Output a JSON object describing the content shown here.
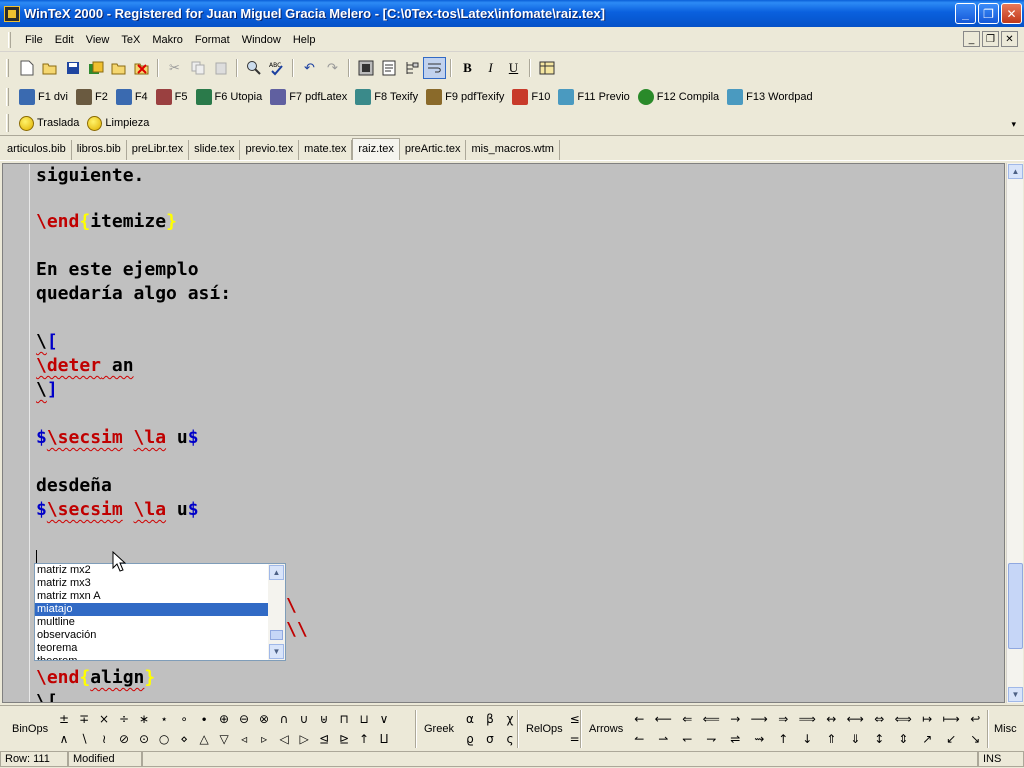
{
  "window": {
    "title": "WinTeX 2000 - Registered for Juan Miguel Gracia Melero - [C:\\0Tex-tos\\Latex\\infomate\\raiz.tex]",
    "minimize": "_",
    "maximize": "❐",
    "close": "✕"
  },
  "menu": {
    "items": [
      "File",
      "Edit",
      "View",
      "TeX",
      "Makro",
      "Format",
      "Window",
      "Help"
    ],
    "mdi_min": "_",
    "mdi_restore": "❐",
    "mdi_close": "✕"
  },
  "toolbar": {
    "bold": "B",
    "italic": "I",
    "underline": "U"
  },
  "fkeys": [
    "F1 dvi",
    "F2",
    "F4",
    "F5",
    "F6 Utopia",
    "F7 pdfLatex",
    "F8 Texify",
    "F9 pdfTexify",
    "F10",
    "F11 Previo",
    "F12 Compila",
    "F13 Wordpad"
  ],
  "macros": [
    "Traslada",
    "Limpieza"
  ],
  "tabs": [
    "articulos.bib",
    "libros.bib",
    "preLibr.tex",
    "slide.tex",
    "previo.tex",
    "mate.tex",
    "raiz.tex",
    "preArtic.tex",
    "mis_macros.wtm"
  ],
  "active_tab": "raiz.tex",
  "editor": {
    "l1": "siguiente.",
    "l2_cmd": "\\end",
    "l2_open": "{",
    "l2_arg": "itemize",
    "l2_close": "}",
    "l3": "En este ejemplo",
    "l4": "quedaría algo así:",
    "l5_cmd": "\\",
    "l5_br": "[",
    "l6_cmd": "\\deter",
    "l6_rest": " an",
    "l7_cmd": "\\",
    "l7_br": "]",
    "l8_d1": "$",
    "l8_c1": "\\secsim",
    "l8_c2": "\\la",
    "l8_u": " u",
    "l8_d2": "$",
    "l9": "desdeña",
    "l10_d1": "$",
    "l10_c1": "\\secsim",
    "l10_c2": "\\la",
    "l10_u": " u",
    "l10_d2": "$",
    "l12_trail": "\\",
    "l13_trail": "\\\\",
    "l14_cmd": "\\end",
    "l14_open": "{",
    "l14_arg": "align",
    "l14_close": "}",
    "l15": "\\["
  },
  "autocomplete": {
    "items": [
      "matriz mx2",
      "matriz mx3",
      "matriz mxn A",
      "miatajo",
      "multline",
      "observación",
      "teorema",
      "theorem"
    ],
    "selected": "miatajo"
  },
  "symbols": {
    "binops_label": "BinOps",
    "binops_row1": [
      "±",
      "∓",
      "×",
      "÷",
      "∗",
      "⋆",
      "∘",
      "∙",
      "⊕",
      "⊖",
      "⊗",
      "∩",
      "∪",
      "⊎",
      "⊓",
      "⊔",
      "∨"
    ],
    "binops_row2": [
      "∧",
      "∖",
      "≀",
      "⊘",
      "⊙",
      "○",
      "⋄",
      "△",
      "▽",
      "◃",
      "▹",
      "◁",
      "▷",
      "⊴",
      "⊵",
      "↑",
      "⨿"
    ],
    "greek_label": "Greek",
    "greek_row1": [
      "α",
      "β",
      "χ"
    ],
    "greek_row2": [
      "ϱ",
      "σ",
      "ς"
    ],
    "relops_label": "RelOps",
    "relops_row1": [
      "≤"
    ],
    "relops_row2": [
      "="
    ],
    "arrows_label": "Arrows",
    "arrows_row1": [
      "←",
      "⟵",
      "⇐",
      "⟸",
      "→",
      "⟶",
      "⇒",
      "⟹",
      "↔",
      "⟷",
      "⇔",
      "⟺",
      "↦",
      "⟼",
      "↩"
    ],
    "arrows_row2": [
      "↼",
      "⇀",
      "↽",
      "⇁",
      "⇌",
      "⇝",
      "↑",
      "↓",
      "⇑",
      "⇓",
      "↕",
      "⇕",
      "↗",
      "↙",
      "↘"
    ],
    "misc_label": "Misc"
  },
  "status": {
    "row": "Row: 111",
    "modified": "Modified",
    "mode": "INS"
  }
}
